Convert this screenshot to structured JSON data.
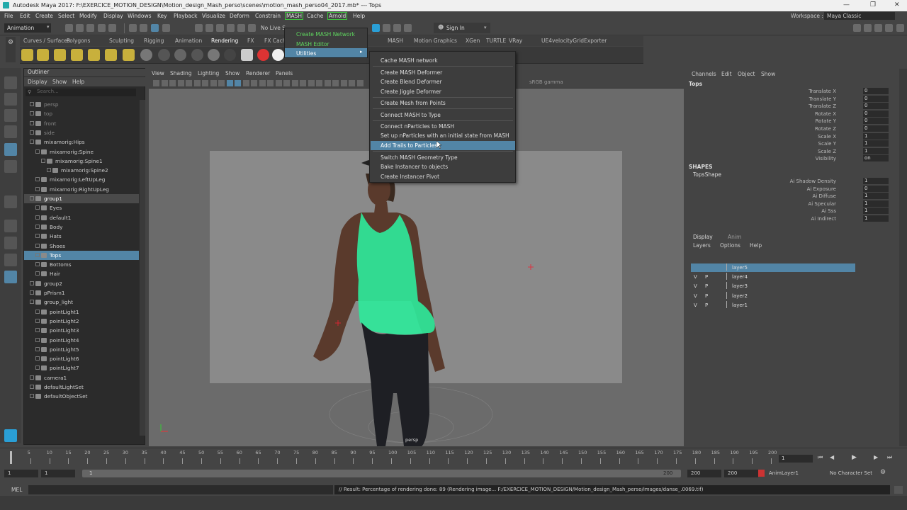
{
  "window": {
    "title": "Autodesk Maya 2017: F:\\EXERCICE_MOTION_DESIGN\\Motion_design_Mash_perso\\scenes\\motion_mash_perso04_2017.mb*   ---   Tops",
    "workspace_label": "Workspace :",
    "workspace_value": "Maya Classic"
  },
  "menubar": [
    "File",
    "Edit",
    "Create",
    "Select",
    "Modify",
    "Display",
    "Windows",
    "Key",
    "Playback",
    "Visualize",
    "Deform",
    "Constrain",
    "MASH",
    "Cache",
    "Arnold",
    "Help"
  ],
  "toolbar": {
    "mode": "Animation",
    "no_live": "No Live S",
    "sign_in": "Sign In"
  },
  "shelf_tabs": [
    "Curves / Surfaces",
    "Polygons",
    "Sculpting",
    "Rigging",
    "Animation",
    "Rendering",
    "FX",
    "FX Cach",
    "ost",
    "MASH",
    "Motion Graphics",
    "XGen",
    "TURTLE",
    "VRay",
    "UE4velocityGridExporter"
  ],
  "outliner": {
    "title": "Outliner",
    "menu": [
      "Display",
      "Show",
      "Help"
    ],
    "search_placeholder": "Search...",
    "rows": [
      "persp",
      "top",
      "front",
      "side",
      "mixamorig:Hips",
      "mixamorig:Spine",
      "mixamorig:Spine1",
      "mixamorig:Spine2",
      "mixamorig:LeftUpLeg",
      "mixamorig:RightUpLeg",
      "group1",
      "Eyes",
      "default1",
      "Body",
      "Hats",
      "Shoes",
      "Tops",
      "Bottoms",
      "Hair",
      "group2",
      "pPrism1",
      "group_light",
      "pointLight1",
      "pointLight2",
      "pointLight3",
      "pointLight4",
      "pointLight5",
      "pointLight6",
      "pointLight7",
      "camera1",
      "defaultLightSet",
      "defaultObjectSet"
    ]
  },
  "viewport": {
    "menu": [
      "View",
      "Shading",
      "Lighting",
      "Show",
      "Renderer",
      "Panels"
    ],
    "color_space": "sRGB gamma",
    "camera_label": "persp"
  },
  "mash_menu": [
    "Create MASH Network",
    "MASH Editor",
    "Utilities"
  ],
  "utilities_menu": [
    "Cache MASH network",
    "Create MASH Deformer",
    "Create Blend Deformer",
    "Create Jiggle Deformer",
    "Create Mesh from Points",
    "Connect MASH to Type",
    "Connect nParticles to MASH",
    "Set up nParticles with an initial state from MASH",
    "Add Trails to Particles",
    "Switch MASH Geometry Type",
    "Bake Instancer to objects",
    "Create Instancer Pivot"
  ],
  "channel_box": {
    "menu": [
      "Channels",
      "Edit",
      "Object",
      "Show"
    ],
    "object": "Tops",
    "attrs": [
      [
        "Translate X",
        "0"
      ],
      [
        "Translate Y",
        "0"
      ],
      [
        "Translate Z",
        "0"
      ],
      [
        "Rotate X",
        "0"
      ],
      [
        "Rotate Y",
        "0"
      ],
      [
        "Rotate Z",
        "0"
      ],
      [
        "Scale X",
        "1"
      ],
      [
        "Scale Y",
        "1"
      ],
      [
        "Scale Z",
        "1"
      ],
      [
        "Visibility",
        "on"
      ]
    ],
    "shapes_header": "SHAPES",
    "shape_name": "TopsShape",
    "shape_attrs": [
      [
        "Ai Shadow Density",
        "1"
      ],
      [
        "Ai Exposure",
        "0"
      ],
      [
        "Ai Diffuse",
        "1"
      ],
      [
        "Ai Specular",
        "1"
      ],
      [
        "Ai Sss",
        "1"
      ],
      [
        "Ai Indirect",
        "1"
      ]
    ]
  },
  "layers": {
    "tabs": [
      "Display",
      "Anim"
    ],
    "menu": [
      "Layers",
      "Options",
      "Help"
    ],
    "rows": [
      "layer5",
      "layer4",
      "layer3",
      "layer2",
      "layer1"
    ]
  },
  "side_tabs": [
    "Channel Box / Layer Editor",
    "Modeling Toolkit",
    "Attribute Editor",
    "Tool Settings"
  ],
  "timeline": {
    "ticks": [
      "5",
      "10",
      "15",
      "20",
      "25",
      "30",
      "35",
      "40",
      "45",
      "50",
      "55",
      "60",
      "65",
      "70",
      "75",
      "80",
      "85",
      "90",
      "95",
      "100",
      "105",
      "110",
      "115",
      "120",
      "125",
      "130",
      "135",
      "140",
      "145",
      "150",
      "155",
      "160",
      "165",
      "170",
      "175",
      "180",
      "185",
      "190",
      "195",
      "200"
    ],
    "current": "1"
  },
  "range": {
    "start": "1",
    "start2": "1",
    "slider_start": "1",
    "slider_end": "200",
    "end": "200",
    "end2": "200",
    "anim_layer": "AnimLayer1",
    "char_set": "No Character Set"
  },
  "cmdline": {
    "label": "MEL",
    "result": "// Result: Percentage of rendering done: 89 (Rendering image... F:/EXERCICE_MOTION_DESIGN/Motion_design_Mash_perso/images/danse_.0069.tif)"
  },
  "colors": {
    "accent": "#5285a6",
    "mash_green": "#5fd65f",
    "wire": "#2fe89a"
  }
}
